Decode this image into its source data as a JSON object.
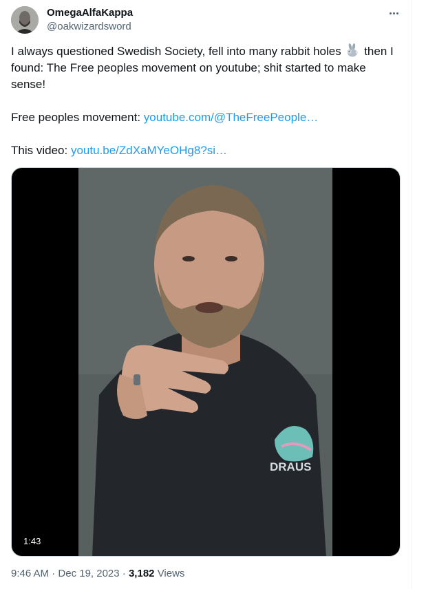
{
  "tweet": {
    "author": {
      "display_name": "OmegaAlfaKappa",
      "handle": "@oakwizardsword",
      "avatar_icon": "user-avatar"
    },
    "more_icon": "more-options-icon",
    "text": {
      "line1_before": "I always questioned Swedish Society, fell into many rabbit holes",
      "emoji": "rabbit-emoji",
      "line1_after": "then I found: The Free peoples movement on youtube; shit started to make sense!",
      "movement_label": "Free peoples movement:",
      "movement_link": "youtube.com/@TheFreePeople…",
      "video_label": "This video:",
      "video_link": "youtu.be/ZdXaMYeOHg8?si…"
    },
    "media": {
      "duration": "1:43",
      "shirt_text": "DRAUS"
    },
    "meta": {
      "time": "9:46 AM",
      "separator": "·",
      "date": "Dec 19, 2023",
      "views_count": "3,182",
      "views_label": "Views"
    },
    "colors": {
      "link": "#1d9bf0",
      "secondary_text": "#536471",
      "primary_text": "#0f1419"
    }
  }
}
